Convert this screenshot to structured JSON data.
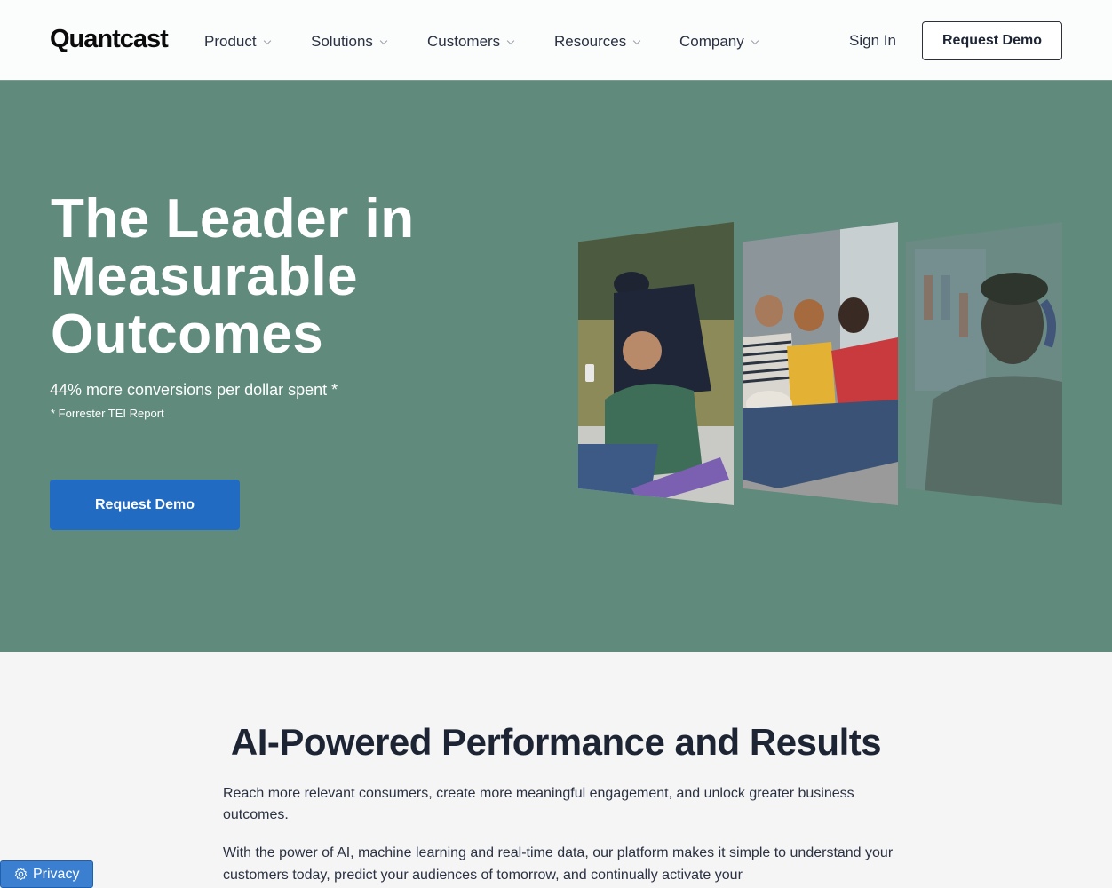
{
  "header": {
    "logo": "Quantcast",
    "nav": [
      {
        "label": "Product"
      },
      {
        "label": "Solutions"
      },
      {
        "label": "Customers"
      },
      {
        "label": "Resources"
      },
      {
        "label": "Company"
      }
    ],
    "sign_in": "Sign In",
    "request_demo": "Request Demo"
  },
  "hero": {
    "title": "The Leader in Measurable Outcomes",
    "subtitle": "44% more conversions per dollar spent *",
    "footnote": "* Forrester TEI Report",
    "cta": "Request Demo",
    "images": [
      {
        "name": "skateboarders-phone-photo"
      },
      {
        "name": "family-watching-tv-photo"
      },
      {
        "name": "man-with-headphones-photo"
      }
    ]
  },
  "section": {
    "title": "AI-Powered Performance and Results",
    "paragraph1": "Reach more relevant consumers, create more meaningful engagement, and unlock greater business outcomes.",
    "paragraph2": "With the power of AI, machine learning and real-time data, our platform makes it simple to understand your customers today, predict your audiences of tomorrow, and continually activate your"
  },
  "privacy": {
    "label": "Privacy",
    "icon": "gear-icon"
  },
  "colors": {
    "hero_bg": "#5f8a7c",
    "primary_button": "#216bc3",
    "privacy_button": "#3a7fd0",
    "text_dark": "#1d2433"
  }
}
